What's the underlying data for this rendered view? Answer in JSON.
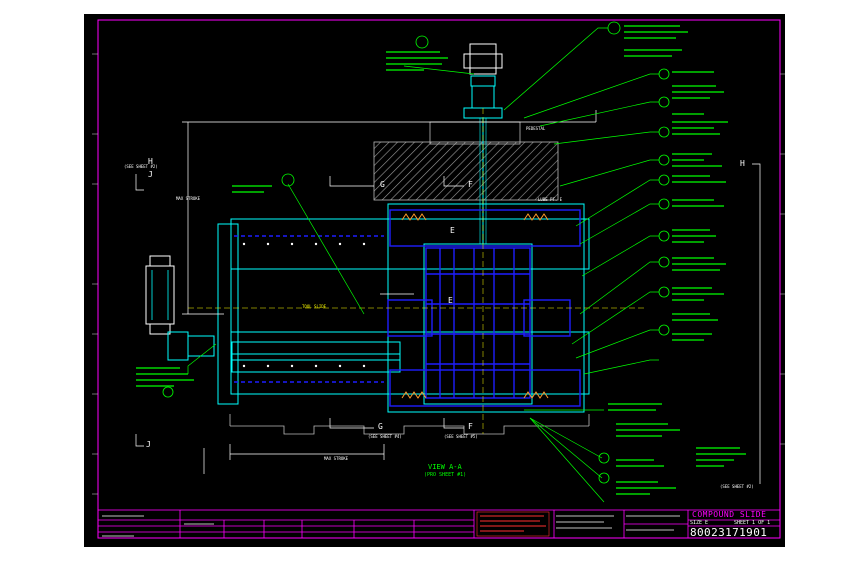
{
  "title_block": {
    "drawing_title": "COMPOUND SLIDE",
    "drawing_number": "80023171901",
    "sheet_info": "SHEET 1 OF 1",
    "size_label": "SIZE E"
  },
  "view_label": "VIEW A-A",
  "view_sub_label": "(PRO SHEET #1)",
  "section_labels": {
    "h_left": "H",
    "h_right": "H",
    "j_left": "J",
    "j_left_bottom": "J",
    "g_top": "G",
    "g_bottom": "G",
    "f_top": "F",
    "f_bottom": "F",
    "e_mid": "E",
    "e_upper": "E"
  },
  "see_sheet_labels": {
    "left_top": "(SEE SHEET #2)",
    "bottom_g": "(SEE SHEET #4)",
    "bottom_f": "(SEE SHEET #5)",
    "right_bottom": "(SEE SHEET #2)"
  },
  "dimension_labels": {
    "max_travel_left": "MAX STROKE",
    "max_travel_bottom": "MAX STROKE",
    "tool_slide": "TOOL SLIDE",
    "lube_pt": "LUBE PT. E",
    "pedestal": "PEDESTAL"
  },
  "colors": {
    "sheet_bg": "#000000",
    "frame": "#ff00ff",
    "green": "#00ff00",
    "cyan": "#00ffff",
    "blue": "#1e1eff",
    "white": "#ffffff",
    "yellow": "#ffff00",
    "red": "#ff3030",
    "hatch": "#bbbbbb"
  }
}
